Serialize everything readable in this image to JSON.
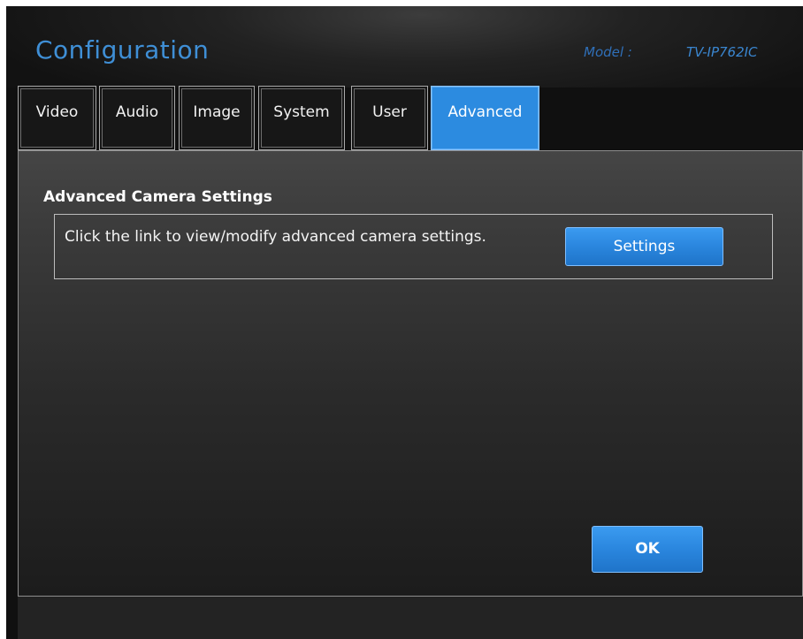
{
  "header": {
    "title": "Configuration",
    "model_label": "Model :",
    "model_value": "TV-IP762IC"
  },
  "tabs": [
    {
      "label": "Video",
      "active": false
    },
    {
      "label": "Audio",
      "active": false
    },
    {
      "label": "Image",
      "active": false
    },
    {
      "label": "System",
      "active": false
    },
    {
      "label": "User",
      "active": false
    },
    {
      "label": "Advanced",
      "active": true
    }
  ],
  "content": {
    "section_title": "Advanced Camera Settings",
    "description": "Click the link to view/modify advanced camera settings.",
    "settings_button": "Settings",
    "ok_button": "OK"
  },
  "colors": {
    "accent": "#2c8be0",
    "title_blue": "#3f8fd6",
    "background": "#101010"
  }
}
